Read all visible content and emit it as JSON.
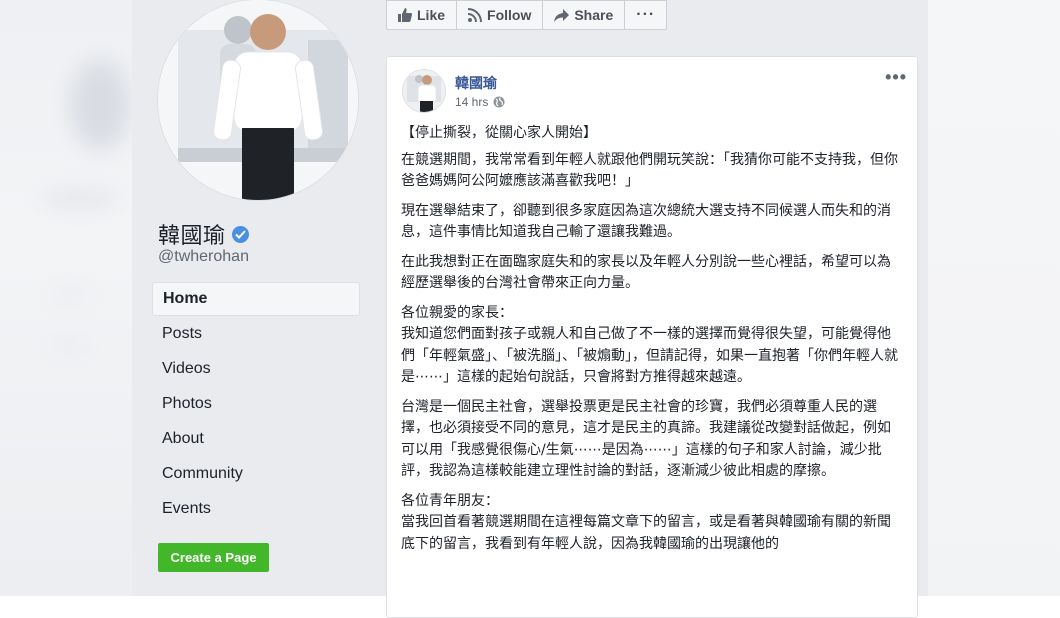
{
  "page": {
    "name": "韓國瑜",
    "handle": "@twherohan"
  },
  "nav": {
    "items": [
      "Home",
      "Posts",
      "Videos",
      "Photos",
      "About",
      "Community",
      "Events"
    ],
    "active": "Home"
  },
  "create_page_label": "Create a Page",
  "actions": {
    "like": "Like",
    "follow": "Follow",
    "share": "Share",
    "more": "···"
  },
  "post": {
    "author": "韓國瑜",
    "time": "14 hrs",
    "more": "•••",
    "paragraphs": [
      "【停止撕裂，從關心家人開始】",
      "在競選期間，我常常看到年輕人就跟他們開玩笑說：「我猜你可能不支持我，但你爸爸媽媽阿公阿嬤應該滿喜歡我吧！」",
      "現在選舉結束了，卻聽到很多家庭因為這次總統大選支持不同候選人而失和的消息，這件事情比知道我自己輸了還讓我難過。",
      "在此我想對正在面臨家庭失和的家長以及年輕人分別說一些心裡話，希望可以為經歷選舉後的台灣社會帶來正向力量。",
      "各位親愛的家長：\n我知道您們面對孩子或親人和自己做了不一樣的選擇而覺得很失望，可能覺得他們「年輕氣盛」、「被洗腦」、「被煽動」，但請記得，如果一直抱著「你們年輕人就是⋯⋯」這樣的起始句說話，只會將對方推得越來越遠。",
      "台灣是一個民主社會，選舉投票更是民主社會的珍寶，我們必須尊重人民的選擇，也必須接受不同的意見，這才是民主的真諦。我建議從改變對話做起，例如可以用「我感覺很傷心/生氣⋯⋯是因為⋯⋯」這樣的句子和家人討論，減少批評，我認為這樣較能建立理性討論的對話，逐漸減少彼此相處的摩擦。",
      "各位青年朋友：\n當我回首看著競選期間在這裡每篇文章下的留言，或是看著與韓國瑜有關的新聞底下的留言，我看到有年輕人說，因為我韓國瑜的出現讓他的"
    ]
  },
  "colors": {
    "link": "#385898",
    "verified": "#4a90e2",
    "create_page": "#42b72a",
    "sidebar_bg": "#e9ebee"
  }
}
